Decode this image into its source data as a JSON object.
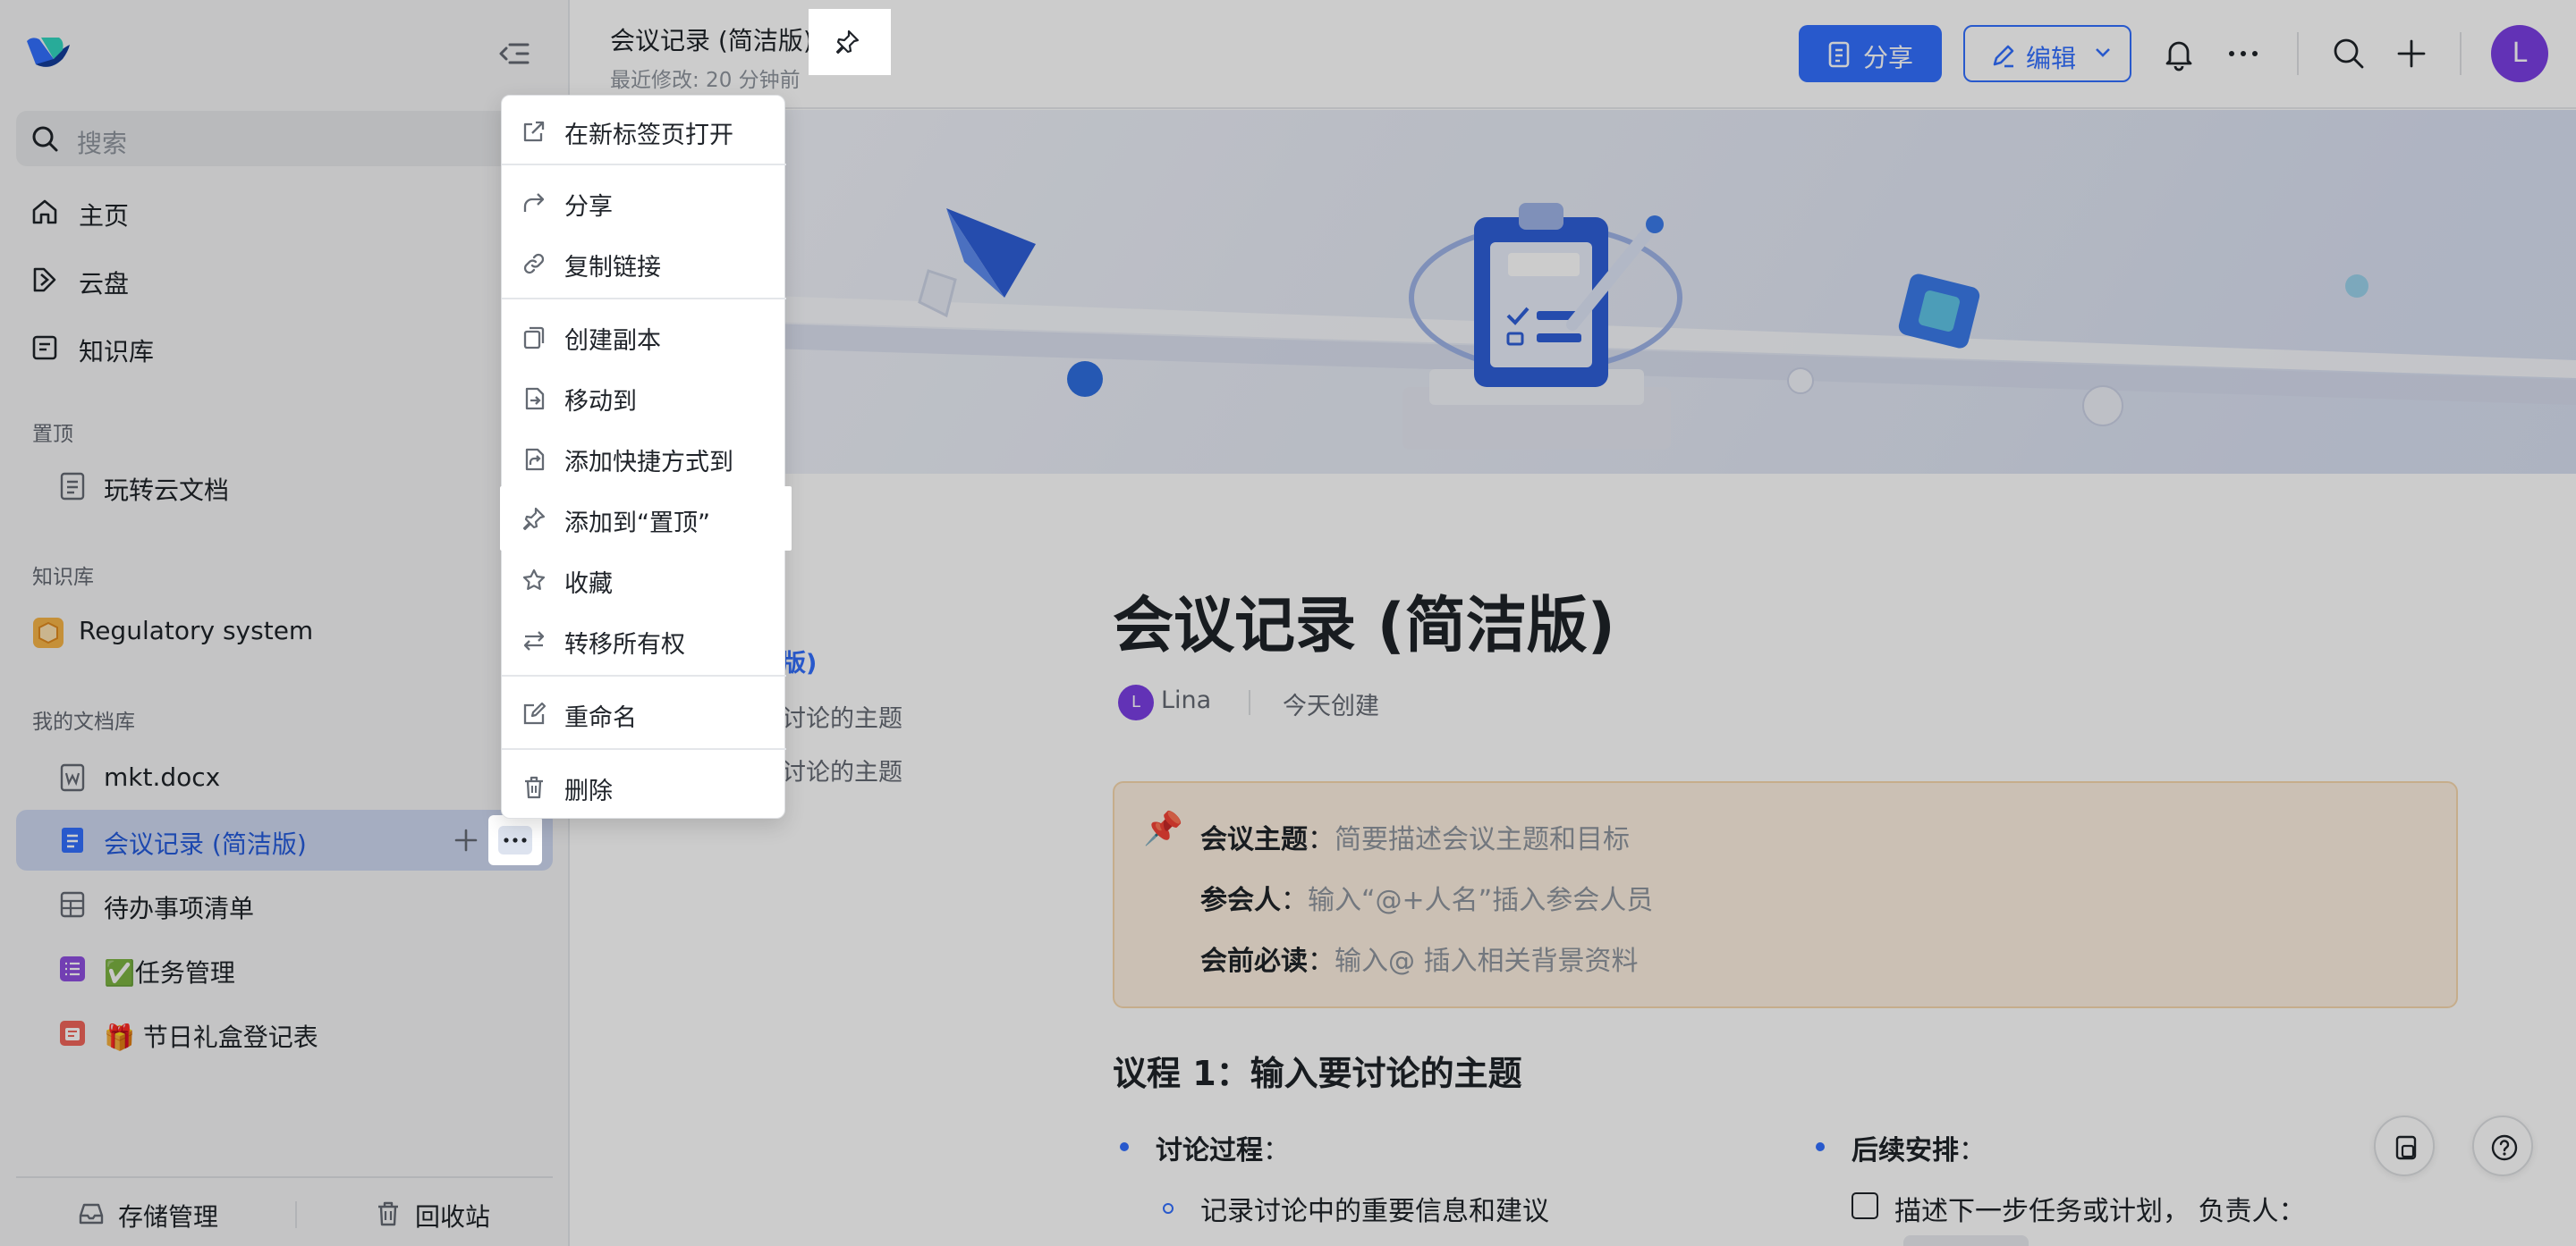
{
  "sidebar": {
    "search_placeholder": "搜索",
    "nav": [
      {
        "label": "主页"
      },
      {
        "label": "云盘"
      },
      {
        "label": "知识库"
      }
    ],
    "pinned_title": "置顶",
    "pinned_items": [
      {
        "label": "玩转云文档"
      }
    ],
    "wiki_title": "知识库",
    "wiki_items": [
      {
        "label": "Regulatory system"
      }
    ],
    "mydocs_title": "我的文档库",
    "mydocs_items": [
      {
        "label": "mkt.docx"
      },
      {
        "label": "会议记录 (简洁版)"
      },
      {
        "label": "待办事项清单"
      },
      {
        "label": "✅任务管理"
      },
      {
        "label": "🎁 节日礼盒登记表"
      }
    ],
    "footer": {
      "storage": "存储管理",
      "trash": "回收站"
    }
  },
  "header": {
    "doc_title": "会议记录 (简洁版)",
    "last_modified": "最近修改: 20 分钟前",
    "share_label": "分享",
    "edit_label": "编辑",
    "avatar_letter": "L"
  },
  "context_menu": {
    "items": [
      {
        "label": "在新标签页打开"
      },
      {
        "label": "分享"
      },
      {
        "label": "复制链接"
      },
      {
        "label": "创建副本"
      },
      {
        "label": "移动到"
      },
      {
        "label": "添加快捷方式到"
      },
      {
        "label": "添加到“置顶”"
      },
      {
        "label": "收藏"
      },
      {
        "label": "转移所有权"
      },
      {
        "label": "重命名"
      },
      {
        "label": "删除"
      }
    ]
  },
  "doc": {
    "toc": [
      "版)",
      "讨论的主题",
      "讨论的主题"
    ],
    "title": "会议记录 (简洁版)",
    "author_initial": "L",
    "author": "Lina",
    "created": "今天创建",
    "callout": {
      "pin": "📌",
      "rows": [
        {
          "key": "会议主题",
          "sep": "：",
          "value": "简要描述会议主题和目标"
        },
        {
          "key": "参会人",
          "sep": "：",
          "value": "输入“@+人名”插入参会人员"
        },
        {
          "key": "会前必读",
          "sep": "：",
          "value": "输入@ 插入相关背景资料"
        }
      ]
    },
    "agenda_title": "议程 1：输入要讨论的主题",
    "discussion_label": "讨论过程",
    "discussion_colon": "：",
    "discussion_item": "记录讨论中的重要信息和建议",
    "followup_label": "后续安排",
    "followup_colon": "：",
    "followup_task": "描述下一步任务或计划， 负责人："
  },
  "colors": {
    "accent": "#3370ff",
    "avatar": "#7b3fe4",
    "callout_bg": "#fef1e1"
  }
}
